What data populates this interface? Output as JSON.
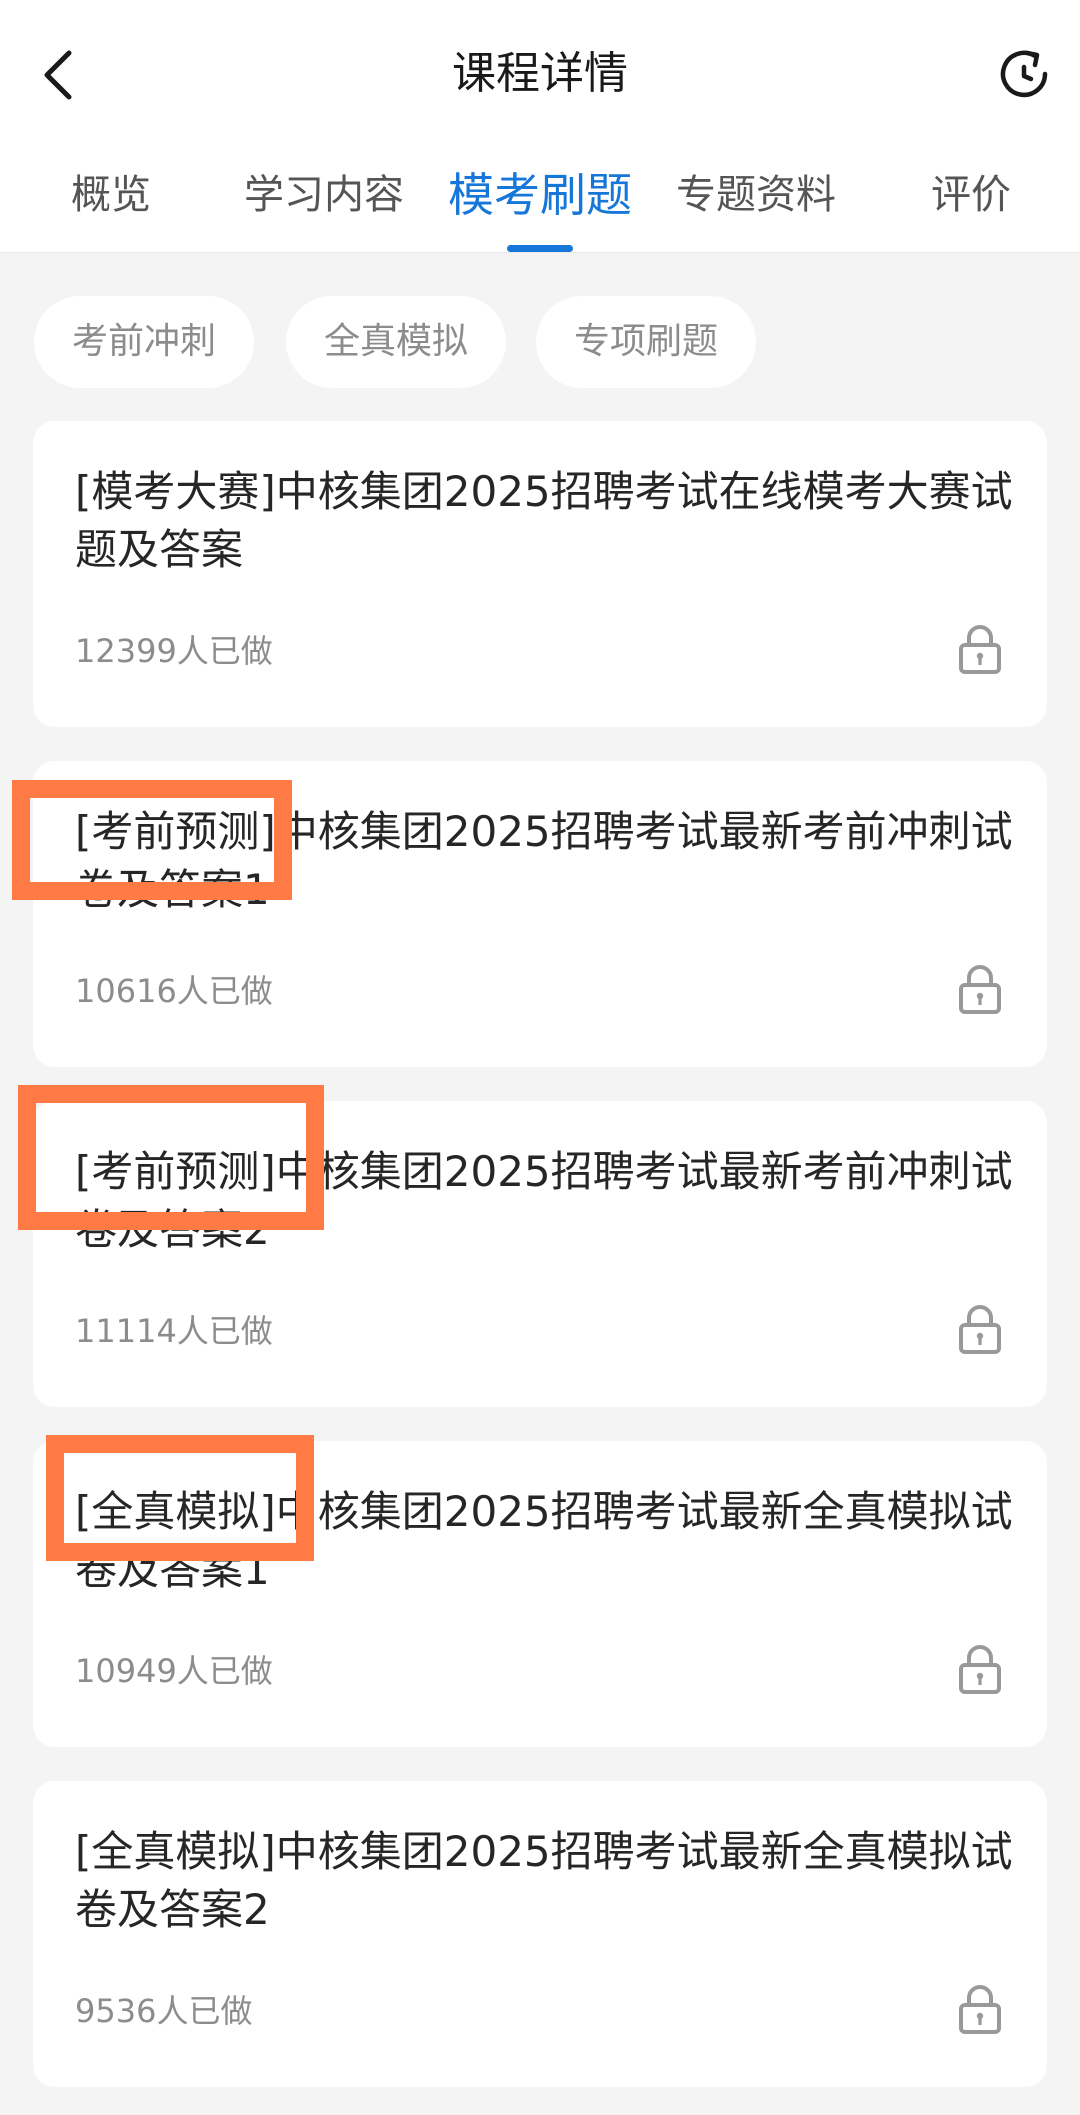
{
  "header": {
    "title": "课程详情",
    "back_icon": "chevron-left-icon",
    "refresh_icon": "refresh-icon"
  },
  "tabs": [
    {
      "label": "概览",
      "active": false
    },
    {
      "label": "学习内容",
      "active": false
    },
    {
      "label": "模考刷题",
      "active": true
    },
    {
      "label": "专题资料",
      "active": false
    },
    {
      "label": "评价",
      "active": false
    }
  ],
  "filters": [
    {
      "label": "考前冲刺"
    },
    {
      "label": "全真模拟"
    },
    {
      "label": "专项刷题"
    }
  ],
  "exams": [
    {
      "title": "[模考大赛]中核集团2025招聘考试在线模考大赛试题及答案",
      "count": "12399人已做",
      "locked": true
    },
    {
      "title": "[考前预测]中核集团2025招聘考试最新考前冲刺试卷及答案1",
      "count": "10616人已做",
      "locked": true
    },
    {
      "title": "[考前预测]中核集团2025招聘考试最新考前冲刺试卷及答案2",
      "count": "11114人已做",
      "locked": true
    },
    {
      "title": "[全真模拟]中核集团2025招聘考试最新全真模拟试卷及答案1",
      "count": "10949人已做",
      "locked": true
    },
    {
      "title": "[全真模拟]中核集团2025招聘考试最新全真模拟试卷及答案2",
      "count": "9536人已做",
      "locked": true
    }
  ],
  "colors": {
    "accent": "#1677d9",
    "highlight": "#ff7a45",
    "muted_text": "#8c8c8c",
    "background": "#f4f4f4"
  }
}
